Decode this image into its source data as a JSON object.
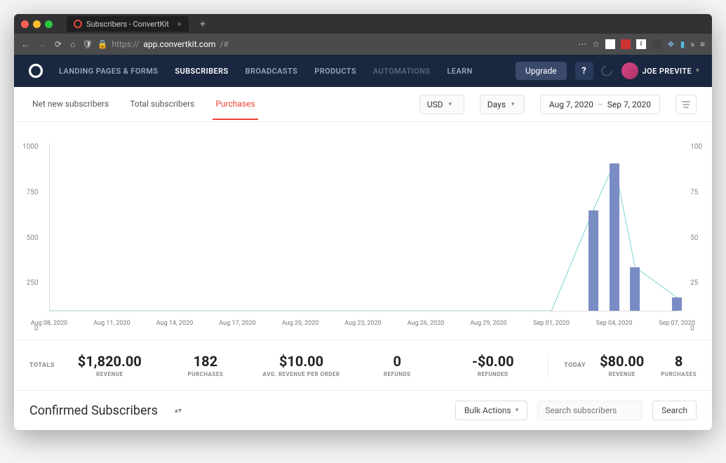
{
  "browser": {
    "tab_title": "Subscribers - ConvertKit",
    "url_prefix": "https://",
    "url_host": "app.convertkit.com",
    "url_path": "/#"
  },
  "nav": {
    "items": [
      "LANDING PAGES & FORMS",
      "SUBSCRIBERS",
      "BROADCASTS",
      "PRODUCTS",
      "AUTOMATIONS",
      "LEARN"
    ],
    "active_index": 1,
    "muted_index": 4,
    "upgrade": "Upgrade",
    "help": "?",
    "user_name": "JOE PREVITE"
  },
  "subnav": {
    "tabs": [
      "Net new subscribers",
      "Total subscribers",
      "Purchases"
    ],
    "active_index": 2,
    "currency": "USD",
    "granularity": "Days",
    "date_from": "Aug 7, 2020",
    "date_to": "Sep 7, 2020"
  },
  "chart_data": {
    "type": "bar",
    "categories": [
      "Aug 08, 2020",
      "Aug 11, 2020",
      "Aug 14, 2020",
      "Aug 17, 2020",
      "Aug 20, 2020",
      "Aug 23, 2020",
      "Aug 26, 2020",
      "Aug 29, 2020",
      "Sep 01, 2020",
      "Sep 04, 2020",
      "Sep 07, 2020"
    ],
    "left_axis": {
      "label": "",
      "ticks": [
        1000,
        750,
        500,
        250,
        0
      ]
    },
    "right_axis": {
      "label": "",
      "ticks": [
        100,
        75,
        50,
        25,
        0
      ]
    },
    "series": [
      {
        "name": "bars",
        "axis": "right",
        "type": "bar",
        "x": [
          "Sep 03, 2020",
          "Sep 04, 2020",
          "Sep 05, 2020",
          "Sep 07, 2020"
        ],
        "values": [
          60,
          88,
          26,
          8
        ]
      },
      {
        "name": "line",
        "axis": "right",
        "type": "line",
        "x": [
          "Aug 08, 2020",
          "Sep 01, 2020",
          "Sep 03, 2020",
          "Sep 04, 2020",
          "Sep 05, 2020",
          "Sep 07, 2020"
        ],
        "values": [
          0,
          0,
          60,
          88,
          26,
          8
        ]
      }
    ]
  },
  "totals": {
    "label": "TOTALS",
    "items": [
      {
        "value": "$1,820.00",
        "caption": "REVENUE"
      },
      {
        "value": "182",
        "caption": "PURCHASES"
      },
      {
        "value": "$10.00",
        "caption": "AVG. REVENUE PER ORDER"
      },
      {
        "value": "0",
        "caption": "REFUNDS"
      },
      {
        "value": "-$0.00",
        "caption": "REFUNDED"
      }
    ],
    "today_label": "TODAY",
    "today": [
      {
        "value": "$80.00",
        "caption": "REVENUE"
      },
      {
        "value": "8",
        "caption": "PURCHASES"
      }
    ]
  },
  "bottom": {
    "title": "Confirmed Subscribers",
    "bulk": "Bulk Actions",
    "search_placeholder": "Search subscribers",
    "search_button": "Search"
  }
}
